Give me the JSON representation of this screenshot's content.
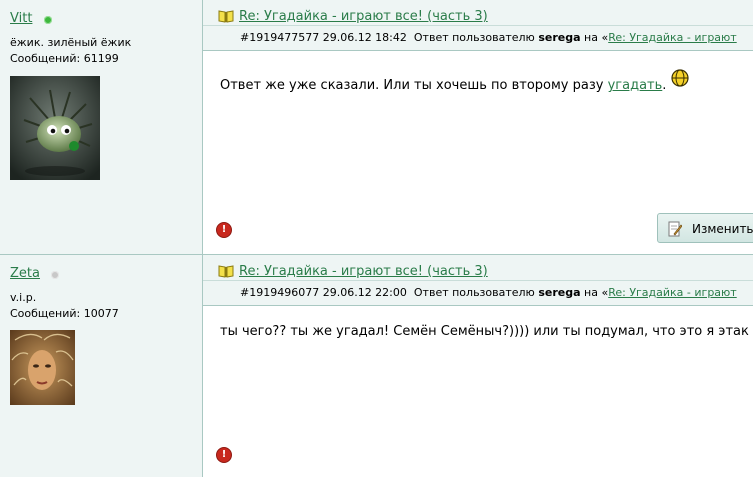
{
  "posts": [
    {
      "author": {
        "name": "Vitt",
        "online": true,
        "title": "ёжик. зилёный ёжик",
        "messages": "Сообщений: 61199",
        "avatar_icon": "hedgehog-avatar"
      },
      "title": "Re: Угадайка - играют все! (часть 3)",
      "number": "#1919477577",
      "datetime": "29.06.12 18:42",
      "reply_prefix": "Ответ пользователю",
      "reply_user": "serega",
      "reply_on": "на «",
      "reply_link": "Re: Угадайка - играют",
      "body_text": "Ответ же уже сказали. Или ты хочешь по второму разу ",
      "body_link": "угадать",
      "body_end": ".",
      "edit_label": "Изменить"
    },
    {
      "author": {
        "name": "Zeta",
        "online": false,
        "title": "v.i.p.",
        "messages": "Сообщений: 10077",
        "avatar_icon": "woman-avatar"
      },
      "title": "Re: Угадайка - играют все! (часть 3)",
      "number": "#1919496077",
      "datetime": "29.06.12 22:00",
      "reply_prefix": "Ответ пользователю",
      "reply_user": "serega",
      "reply_on": "на «",
      "reply_link": "Re: Угадайка - играют",
      "body_text": "ты чего?? ты же угадал! Семён Семёныч?)))) или ты подумал, что это я этак"
    }
  ],
  "colors": {
    "accent": "#2a7c49",
    "panel": "#eef5f4",
    "border": "#a9c8c2",
    "online": "#3db83d",
    "warning": "#c8281e"
  }
}
